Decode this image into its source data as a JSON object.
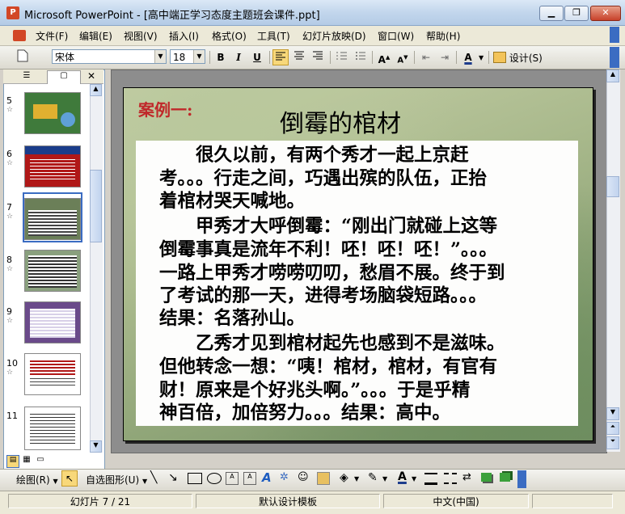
{
  "window": {
    "title": "Microsoft PowerPoint - [高中端正学习态度主题班会课件.ppt]",
    "app_icon_letter": "P",
    "controls": {
      "minimize": "▁",
      "maximize": "❐",
      "close": "✕"
    }
  },
  "menu": [
    "文件(F)",
    "编辑(E)",
    "视图(V)",
    "插入(I)",
    "格式(O)",
    "工具(T)",
    "幻灯片放映(D)",
    "窗口(W)",
    "帮助(H)"
  ],
  "toolbar": {
    "font_name": "宋体",
    "font_size": "18",
    "bold": "B",
    "italic": "I",
    "underline": "U",
    "design_label": "设计(S)"
  },
  "slides_pane": {
    "thumbnails": [
      {
        "number": "5",
        "bg": "#3f7a3b"
      },
      {
        "number": "6",
        "bg": "#b01818"
      },
      {
        "number": "7",
        "bg": "#6b7f58"
      },
      {
        "number": "8",
        "bg": "#8aa07e"
      },
      {
        "number": "9",
        "bg": "#6a4a8a"
      },
      {
        "number": "10",
        "bg": "#ffffff"
      },
      {
        "number": "11",
        "bg": "#ffffff"
      }
    ],
    "selected": "7"
  },
  "slide": {
    "case_label": "案例一:",
    "title": "倒霉的棺材",
    "lines": [
      "　　很久以前，有两个秀才一起上京赶",
      "考。。。行走之间，巧遇出殡的队伍，正抬",
      "着棺材哭天喊地。",
      "　　甲秀才大呼倒霉：“刚出门就碰上这等",
      "倒霉事真是流年不利！呸！呸！呸！”。。。",
      "一路上甲秀才唠唠叨叨，愁眉不展。终于到",
      "了考试的那一天，进得考场脑袋短路。。。",
      "结果：名落孙山。",
      "　　乙秀才见到棺材起先也感到不是滋味。",
      "但他转念一想：“咦！棺材，棺材，有官有",
      "财！原来是个好兆头啊。”。。。于是乎精",
      "神百倍，加倍努力。。。结果：高中。"
    ]
  },
  "drawing_toolbar": {
    "draw_label": "绘图(R)",
    "autoshapes_label": "自选图形(U)"
  },
  "status": {
    "slide_info": "幻灯片 7 / 21",
    "template": "默认设计模板",
    "language": "中文(中国)"
  }
}
